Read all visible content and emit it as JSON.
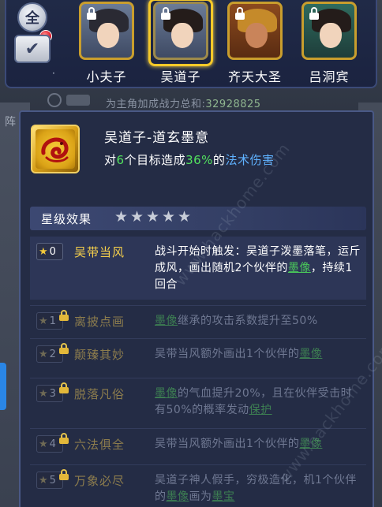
{
  "top_bar": {
    "all_button": "全",
    "characters": [
      {
        "name": "小夫子",
        "locked": true,
        "selected": false
      },
      {
        "name": "吴道子",
        "locked": true,
        "selected": true
      },
      {
        "name": "齐天大圣",
        "locked": true,
        "selected": false
      },
      {
        "name": "吕洞宾",
        "locked": true,
        "selected": false
      }
    ]
  },
  "background": {
    "row_text": "为主角加成战力总和:",
    "row_value": "32928825",
    "side_label": "阵"
  },
  "skill": {
    "title": "吴道子-道玄墨意",
    "desc_prefix": "对",
    "desc_targets": "6",
    "desc_mid": "个目标造成",
    "desc_percent": "36%",
    "desc_of": "的",
    "desc_type": "法术伤害"
  },
  "star_section": {
    "label": "星级效果",
    "stars": 5
  },
  "effects": [
    {
      "level": "0",
      "name": "吴带当风",
      "locked": false,
      "text_parts": [
        {
          "t": "战斗开始时触发：吴道子泼墨落笔，运斤成风，画出随机2个伙伴的"
        },
        {
          "t": "墨像",
          "link": true
        },
        {
          "t": "，持续1回合"
        }
      ]
    },
    {
      "level": "1",
      "name": "离披点画",
      "locked": true,
      "text_parts": [
        {
          "t": "墨像",
          "link": true
        },
        {
          "t": "继承的攻击系数提升至50%"
        }
      ]
    },
    {
      "level": "2",
      "name": "颠臻其妙",
      "locked": true,
      "text_parts": [
        {
          "t": "吴带当风额外画出1个伙伴的"
        },
        {
          "t": "墨像",
          "link": true
        }
      ]
    },
    {
      "level": "3",
      "name": "脱落凡俗",
      "locked": true,
      "text_parts": [
        {
          "t": "墨像",
          "link": true
        },
        {
          "t": "的气血提升20%，且在伙伴受击时有50%的概率发动"
        },
        {
          "t": "保护",
          "link": true
        }
      ]
    },
    {
      "level": "4",
      "name": "六法俱全",
      "locked": true,
      "text_parts": [
        {
          "t": "吴带当风额外画出1个伙伴的"
        },
        {
          "t": "墨像",
          "link": true
        }
      ]
    },
    {
      "level": "5",
      "name": "万象必尽",
      "locked": true,
      "text_parts": [
        {
          "t": "吴道子神人假手，穷极造化，机1个伙伴的"
        },
        {
          "t": "墨像",
          "link": true
        },
        {
          "t": "画为"
        },
        {
          "t": "墨宝",
          "link": true
        }
      ]
    }
  ],
  "watermark": "www.hackhome.com"
}
